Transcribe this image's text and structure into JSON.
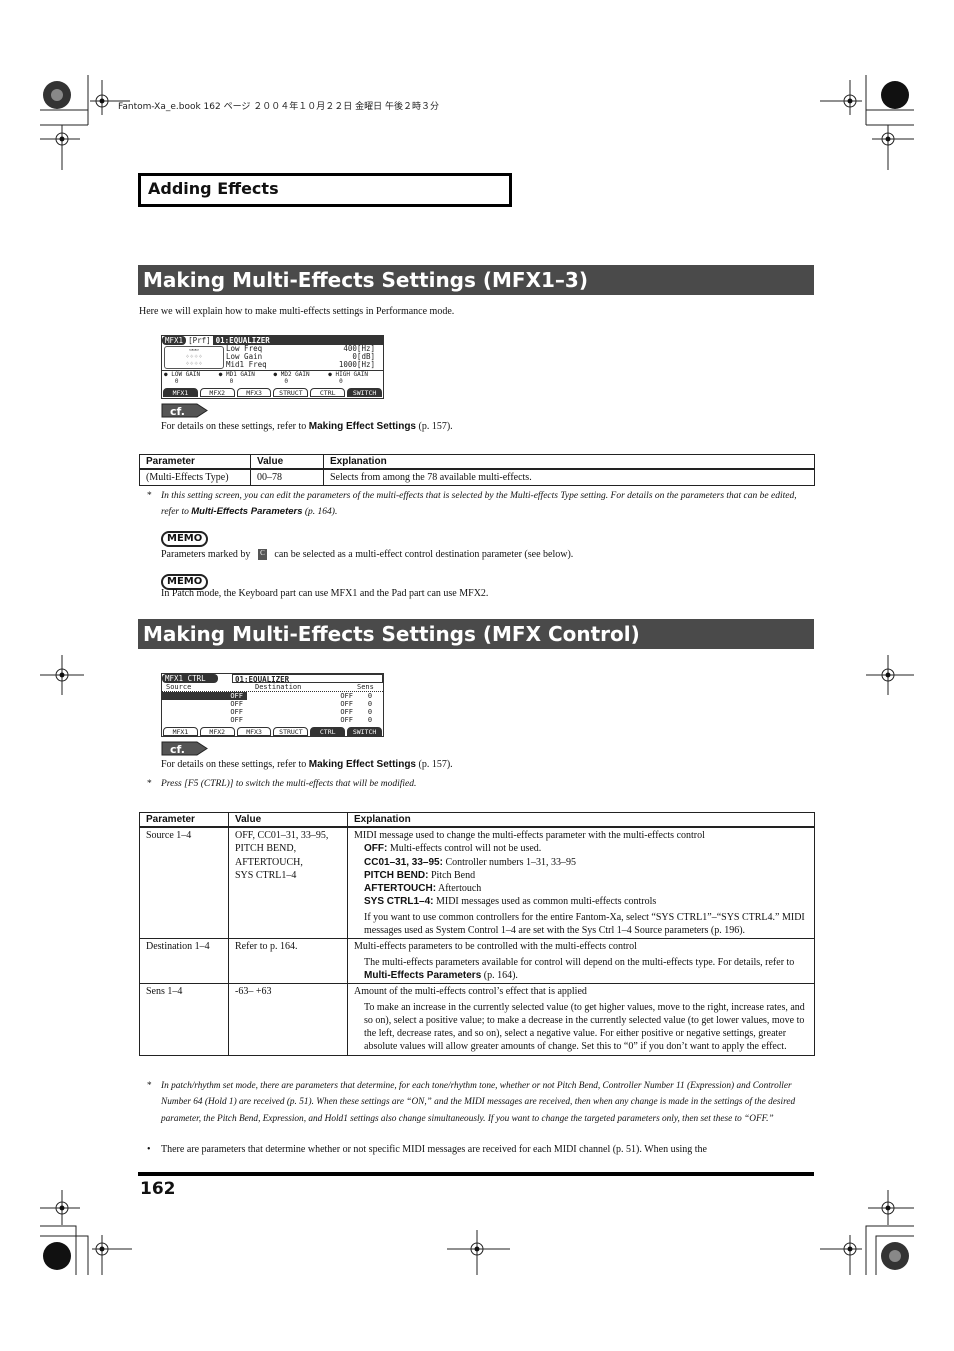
{
  "print_header": "Fantom-Xa_e.book  162 ページ  ２００４年１０月２２日  金曜日  午後２時３分",
  "chapter_box": "Adding Effects",
  "section1": {
    "title": "Making Multi-Effects Settings (MFX1–3)",
    "intro": "Here we will explain how to make multi-effects settings in Performance mode.",
    "lcd": {
      "tag": "MFX1",
      "mode": "[Prf]",
      "effect": "01:EQUALIZER",
      "params": [
        {
          "name": "Low Freq",
          "value": "400[Hz]"
        },
        {
          "name": "Low Gain",
          "value": "0[dB]"
        },
        {
          "name": "Mid1 Freq",
          "value": "1000[Hz]"
        }
      ],
      "knobs": [
        {
          "label": "LOW GAIN",
          "value": "0"
        },
        {
          "label": "MD1 GAIN",
          "value": "0"
        },
        {
          "label": "MD2 GAIN",
          "value": "0"
        },
        {
          "label": "HIGH GAIN",
          "value": "0"
        }
      ],
      "tabs": [
        "MFX1",
        "MFX2",
        "MFX3",
        "STRUCT",
        "CTRL",
        "SWITCH"
      ]
    },
    "cf_label": "cf.",
    "ref_prefix": "For details on these settings, refer to ",
    "ref_bold": "Making Effect Settings",
    "ref_suffix": " (p. 157).",
    "table": {
      "headers": [
        "Parameter",
        "Value",
        "Explanation"
      ],
      "rows": [
        {
          "param": "(Multi-Effects Type)",
          "value": "00–78",
          "explanation": "Selects from among the 78 available multi-effects."
        }
      ]
    },
    "note_text": "In this setting screen, you can edit the parameters of the multi-effects that is selected by the Multi-effects Type setting. For details on the parameters that can be edited, refer to ",
    "note_bold": "Multi-Effects Parameters",
    "note_suffix": " (p. 164).",
    "memo_label": "MEMO",
    "memo1_prefix": "Parameters marked by",
    "memo1_suffix": "can be selected as a multi-effect control destination parameter (see below).",
    "memo2": "In Patch mode, the Keyboard part can use MFX1 and the Pad part can use MFX2."
  },
  "section2": {
    "title": "Making Multi-Effects Settings (MFX Control)",
    "lcd": {
      "tag": "MFX1 CTRL",
      "effect": "01:EQUALIZER",
      "col_source": "Source",
      "col_dest": "Destination",
      "col_sens": "Sens",
      "rows": [
        {
          "source": "OFF",
          "dest": "OFF",
          "sens": "0"
        },
        {
          "source": "OFF",
          "dest": "OFF",
          "sens": "0"
        },
        {
          "source": "OFF",
          "dest": "OFF",
          "sens": "0"
        },
        {
          "source": "OFF",
          "dest": "OFF",
          "sens": "0"
        }
      ],
      "tabs": [
        "MFX1",
        "MFX2",
        "MFX3",
        "STRUCT",
        "CTRL",
        "SWITCH"
      ]
    },
    "cf_label": "cf.",
    "ref_prefix": "For details on these settings, refer to ",
    "ref_bold": "Making Effect Settings",
    "ref_suffix": " (p. 157).",
    "press_note": "Press [F5 (CTRL)] to switch the multi-effects that will be modified.",
    "table": {
      "headers": [
        "Parameter",
        "Value",
        "Explanation"
      ],
      "source": {
        "param": "Source 1–4",
        "value_lines": [
          "OFF, CC01–31, 33–95,",
          "PITCH BEND,",
          "AFTERTOUCH,",
          "SYS CTRL1–4"
        ],
        "main": "MIDI message used to change the multi-effects parameter with the multi-effects control",
        "items": [
          {
            "term": "OFF:",
            "desc": " Multi-effects control will not be used."
          },
          {
            "term": "CC01–31, 33–95:",
            "desc": " Controller numbers 1–31, 33–95"
          },
          {
            "term": "PITCH BEND:",
            "desc": " Pitch Bend"
          },
          {
            "term": "AFTERTOUCH:",
            "desc": " Aftertouch"
          },
          {
            "term": "SYS CTRL1–4:",
            "desc": " MIDI messages used as common multi-effects controls"
          }
        ],
        "extra": "If you want to use common controllers for the entire Fantom-Xa, select “SYS CTRL1”–“SYS CTRL4.” MIDI messages used as System Control 1–4 are set with the Sys Ctrl 1–4 Source parameters (p. 196)."
      },
      "destination": {
        "param": "Destination 1–4",
        "value": "Refer to p. 164.",
        "main": "Multi-effects parameters to be controlled with the multi-effects control",
        "extra_prefix": "The multi-effects parameters available for control will depend on the multi-effects type. For details, refer to ",
        "extra_bold": "Multi-Effects Parameters",
        "extra_suffix": " (p. 164)."
      },
      "sens": {
        "param": "Sens 1–4",
        "value": "-63– +63",
        "main": "Amount of the multi-effects control’s effect that is applied",
        "extra": "To make an increase in the currently selected value (to get higher values, move to the right, increase rates, and so on), select a positive value; to make a decrease in the currently selected value (to get lower values, move to the left, decrease rates, and so on), select a negative value. For either positive or negative settings, greater absolute values will allow greater amounts of change. Set this to “0” if you don’t want to apply the effect."
      }
    },
    "footnote": "In patch/rhythm set mode, there are parameters that determine, for each tone/rhythm tone, whether or not Pitch Bend, Controller Number 11 (Expression) and Controller Number 64 (Hold 1) are received (p. 51). When these settings are “ON,” and the MIDI messages are received, then when any change is made in the settings of the desired parameter, the Pitch Bend, Expression, and Hold1 settings also change simultaneously. If you want to change the targeted parameters only, then set these to “OFF.”",
    "bullet": "There are parameters that determine whether or not specific MIDI messages are received for each MIDI channel (p. 51). When using the"
  },
  "page_number": "162"
}
